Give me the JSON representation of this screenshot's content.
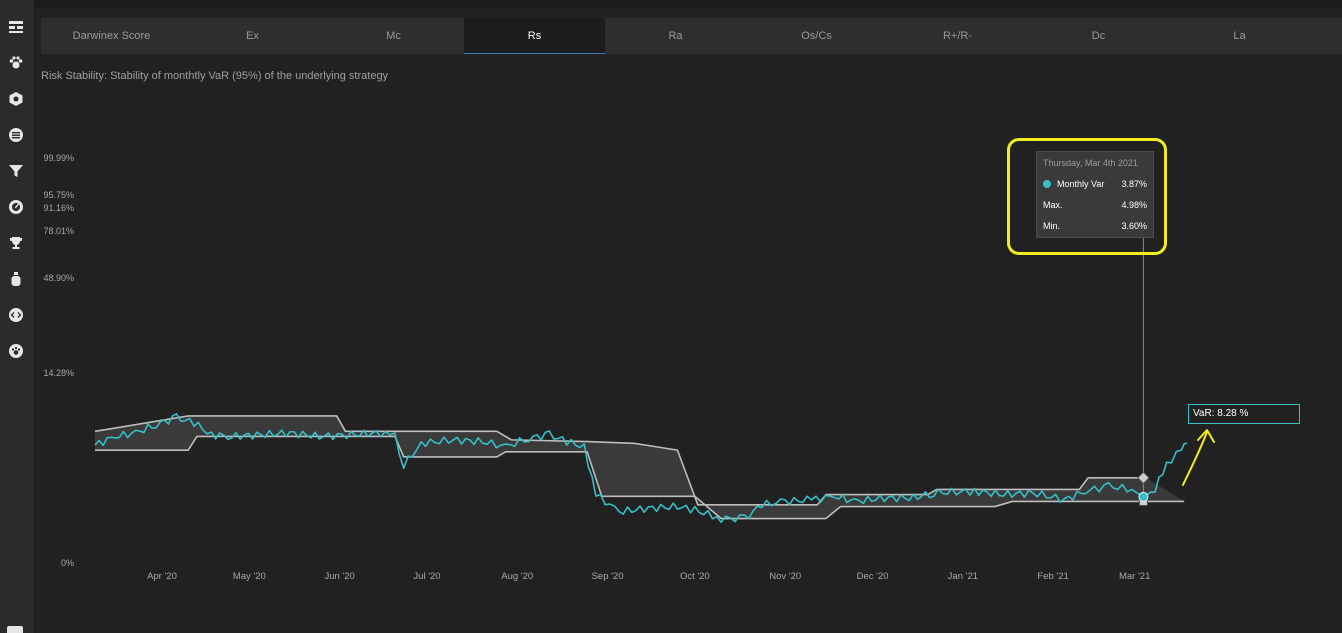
{
  "sidebar": {
    "icons": [
      "dashboard-icon",
      "paw-icon",
      "hexagon-icon",
      "list-icon",
      "filter-icon",
      "gauge-icon",
      "trophy-icon",
      "bottle-icon",
      "code-icon",
      "paw-circle-icon"
    ]
  },
  "tabs": [
    {
      "label": "Darwinex Score",
      "active": false
    },
    {
      "label": "Ex",
      "active": false
    },
    {
      "label": "Mc",
      "active": false
    },
    {
      "label": "Rs",
      "active": true
    },
    {
      "label": "Ra",
      "active": false
    },
    {
      "label": "Os/Cs",
      "active": false
    },
    {
      "label": "R+/R-",
      "active": false
    },
    {
      "label": "Dc",
      "active": false
    },
    {
      "label": "La",
      "active": false
    }
  ],
  "subtitle": "Risk Stability: Stability of monthtly VaR (95%) of the underlying strategy",
  "tooltip": {
    "date": "Thursday, Mar 4th 2021",
    "rows": [
      {
        "label": "Monthly Var",
        "value": "3.87%"
      },
      {
        "label": "Max.",
        "value": "4.98%"
      },
      {
        "label": "Min.",
        "value": "3.60%"
      }
    ]
  },
  "var_label": "VaR: 8.28 %",
  "colors": {
    "monthly_var": "#35bfc6",
    "band_line": "#bdbdbd",
    "band_fill": "#3a3a3a",
    "highlight": "#f1ee1c",
    "active_tab_underline": "#3f7fb7"
  },
  "chart_data": {
    "type": "area",
    "title": "",
    "xlabel": "",
    "ylabel": "",
    "y_tick_labels": [
      "99.99%",
      "95.75%",
      "91.16%",
      "78.01%",
      "48.90%",
      "14.28%",
      "0%"
    ],
    "x_tick_labels": [
      "Apr '20",
      "May '20",
      "Jun '20",
      "Jul '20",
      "Aug '20",
      "Sep '20",
      "Oct '20",
      "Nov '20",
      "Dec '20",
      "Jan '21",
      "Feb '21",
      "Mar '21"
    ],
    "x_range": [
      "2020-03-09",
      "2021-03-20"
    ],
    "legend": "none",
    "series": [
      {
        "name": "Monthly Var",
        "values": [
          [
            "2020-03-09",
            6.9
          ],
          [
            "2020-03-16",
            7.4
          ],
          [
            "2020-03-23",
            7.6
          ],
          [
            "2020-03-30",
            8.1
          ],
          [
            "2020-04-06",
            8.5
          ],
          [
            "2020-04-12",
            8.2
          ],
          [
            "2020-04-18",
            7.5
          ],
          [
            "2020-04-25",
            7.4
          ],
          [
            "2020-05-05",
            7.5
          ],
          [
            "2020-05-15",
            7.6
          ],
          [
            "2020-05-25",
            7.4
          ],
          [
            "2020-06-05",
            7.5
          ],
          [
            "2020-06-15",
            7.6
          ],
          [
            "2020-06-20",
            7.4
          ],
          [
            "2020-06-23",
            5.7
          ],
          [
            "2020-06-29",
            7.0
          ],
          [
            "2020-07-10",
            7.2
          ],
          [
            "2020-07-20",
            7.1
          ],
          [
            "2020-07-28",
            6.8
          ],
          [
            "2020-08-05",
            7.3
          ],
          [
            "2020-08-12",
            7.5
          ],
          [
            "2020-08-18",
            7.1
          ],
          [
            "2020-08-24",
            6.8
          ],
          [
            "2020-08-28",
            4.0
          ],
          [
            "2020-09-05",
            3.0
          ],
          [
            "2020-09-15",
            3.2
          ],
          [
            "2020-09-25",
            3.3
          ],
          [
            "2020-10-01",
            3.1
          ],
          [
            "2020-10-10",
            2.6
          ],
          [
            "2020-10-18",
            2.6
          ],
          [
            "2020-10-24",
            3.4
          ],
          [
            "2020-11-01",
            3.6
          ],
          [
            "2020-11-10",
            3.7
          ],
          [
            "2020-11-18",
            3.9
          ],
          [
            "2020-11-25",
            3.6
          ],
          [
            "2020-12-05",
            3.8
          ],
          [
            "2020-12-15",
            3.8
          ],
          [
            "2020-12-22",
            4.1
          ],
          [
            "2021-01-05",
            4.2
          ],
          [
            "2021-01-15",
            4.0
          ],
          [
            "2021-01-25",
            4.1
          ],
          [
            "2021-02-05",
            3.7
          ],
          [
            "2021-02-12",
            4.2
          ],
          [
            "2021-02-20",
            4.5
          ],
          [
            "2021-02-28",
            4.3
          ],
          [
            "2021-03-04",
            3.87
          ],
          [
            "2021-03-08",
            4.3
          ],
          [
            "2021-03-12",
            5.8
          ],
          [
            "2021-03-17",
            6.6
          ],
          [
            "2021-03-19",
            7.0
          ]
        ]
      },
      {
        "name": "Max.",
        "values": [
          [
            "2020-03-09",
            7.7
          ],
          [
            "2020-04-10",
            8.6
          ],
          [
            "2020-05-31",
            8.6
          ],
          [
            "2020-06-03",
            7.7
          ],
          [
            "2020-07-25",
            7.7
          ],
          [
            "2020-07-30",
            7.2
          ],
          [
            "2020-08-25",
            7.1
          ],
          [
            "2020-09-10",
            7.0
          ],
          [
            "2020-09-25",
            6.6
          ],
          [
            "2020-10-02",
            3.4
          ],
          [
            "2020-11-12",
            3.4
          ],
          [
            "2020-11-15",
            4.0
          ],
          [
            "2020-12-20",
            4.0
          ],
          [
            "2020-12-23",
            4.3
          ],
          [
            "2021-02-10",
            4.3
          ],
          [
            "2021-02-13",
            4.98
          ],
          [
            "2021-03-05",
            4.98
          ]
        ]
      },
      {
        "name": "Min.",
        "values": [
          [
            "2020-03-09",
            6.6
          ],
          [
            "2020-04-10",
            6.6
          ],
          [
            "2020-04-13",
            7.4
          ],
          [
            "2020-06-20",
            7.4
          ],
          [
            "2020-06-23",
            6.2
          ],
          [
            "2020-07-25",
            6.2
          ],
          [
            "2020-07-28",
            6.5
          ],
          [
            "2020-08-25",
            6.5
          ],
          [
            "2020-08-30",
            3.9
          ],
          [
            "2020-10-01",
            3.9
          ],
          [
            "2020-10-10",
            2.6
          ],
          [
            "2020-11-15",
            2.6
          ],
          [
            "2020-11-20",
            3.3
          ],
          [
            "2021-01-12",
            3.3
          ],
          [
            "2021-01-18",
            3.6
          ],
          [
            "2021-02-03",
            3.6
          ],
          [
            "2021-02-10",
            3.6
          ],
          [
            "2021-03-18",
            3.6
          ]
        ]
      }
    ]
  }
}
